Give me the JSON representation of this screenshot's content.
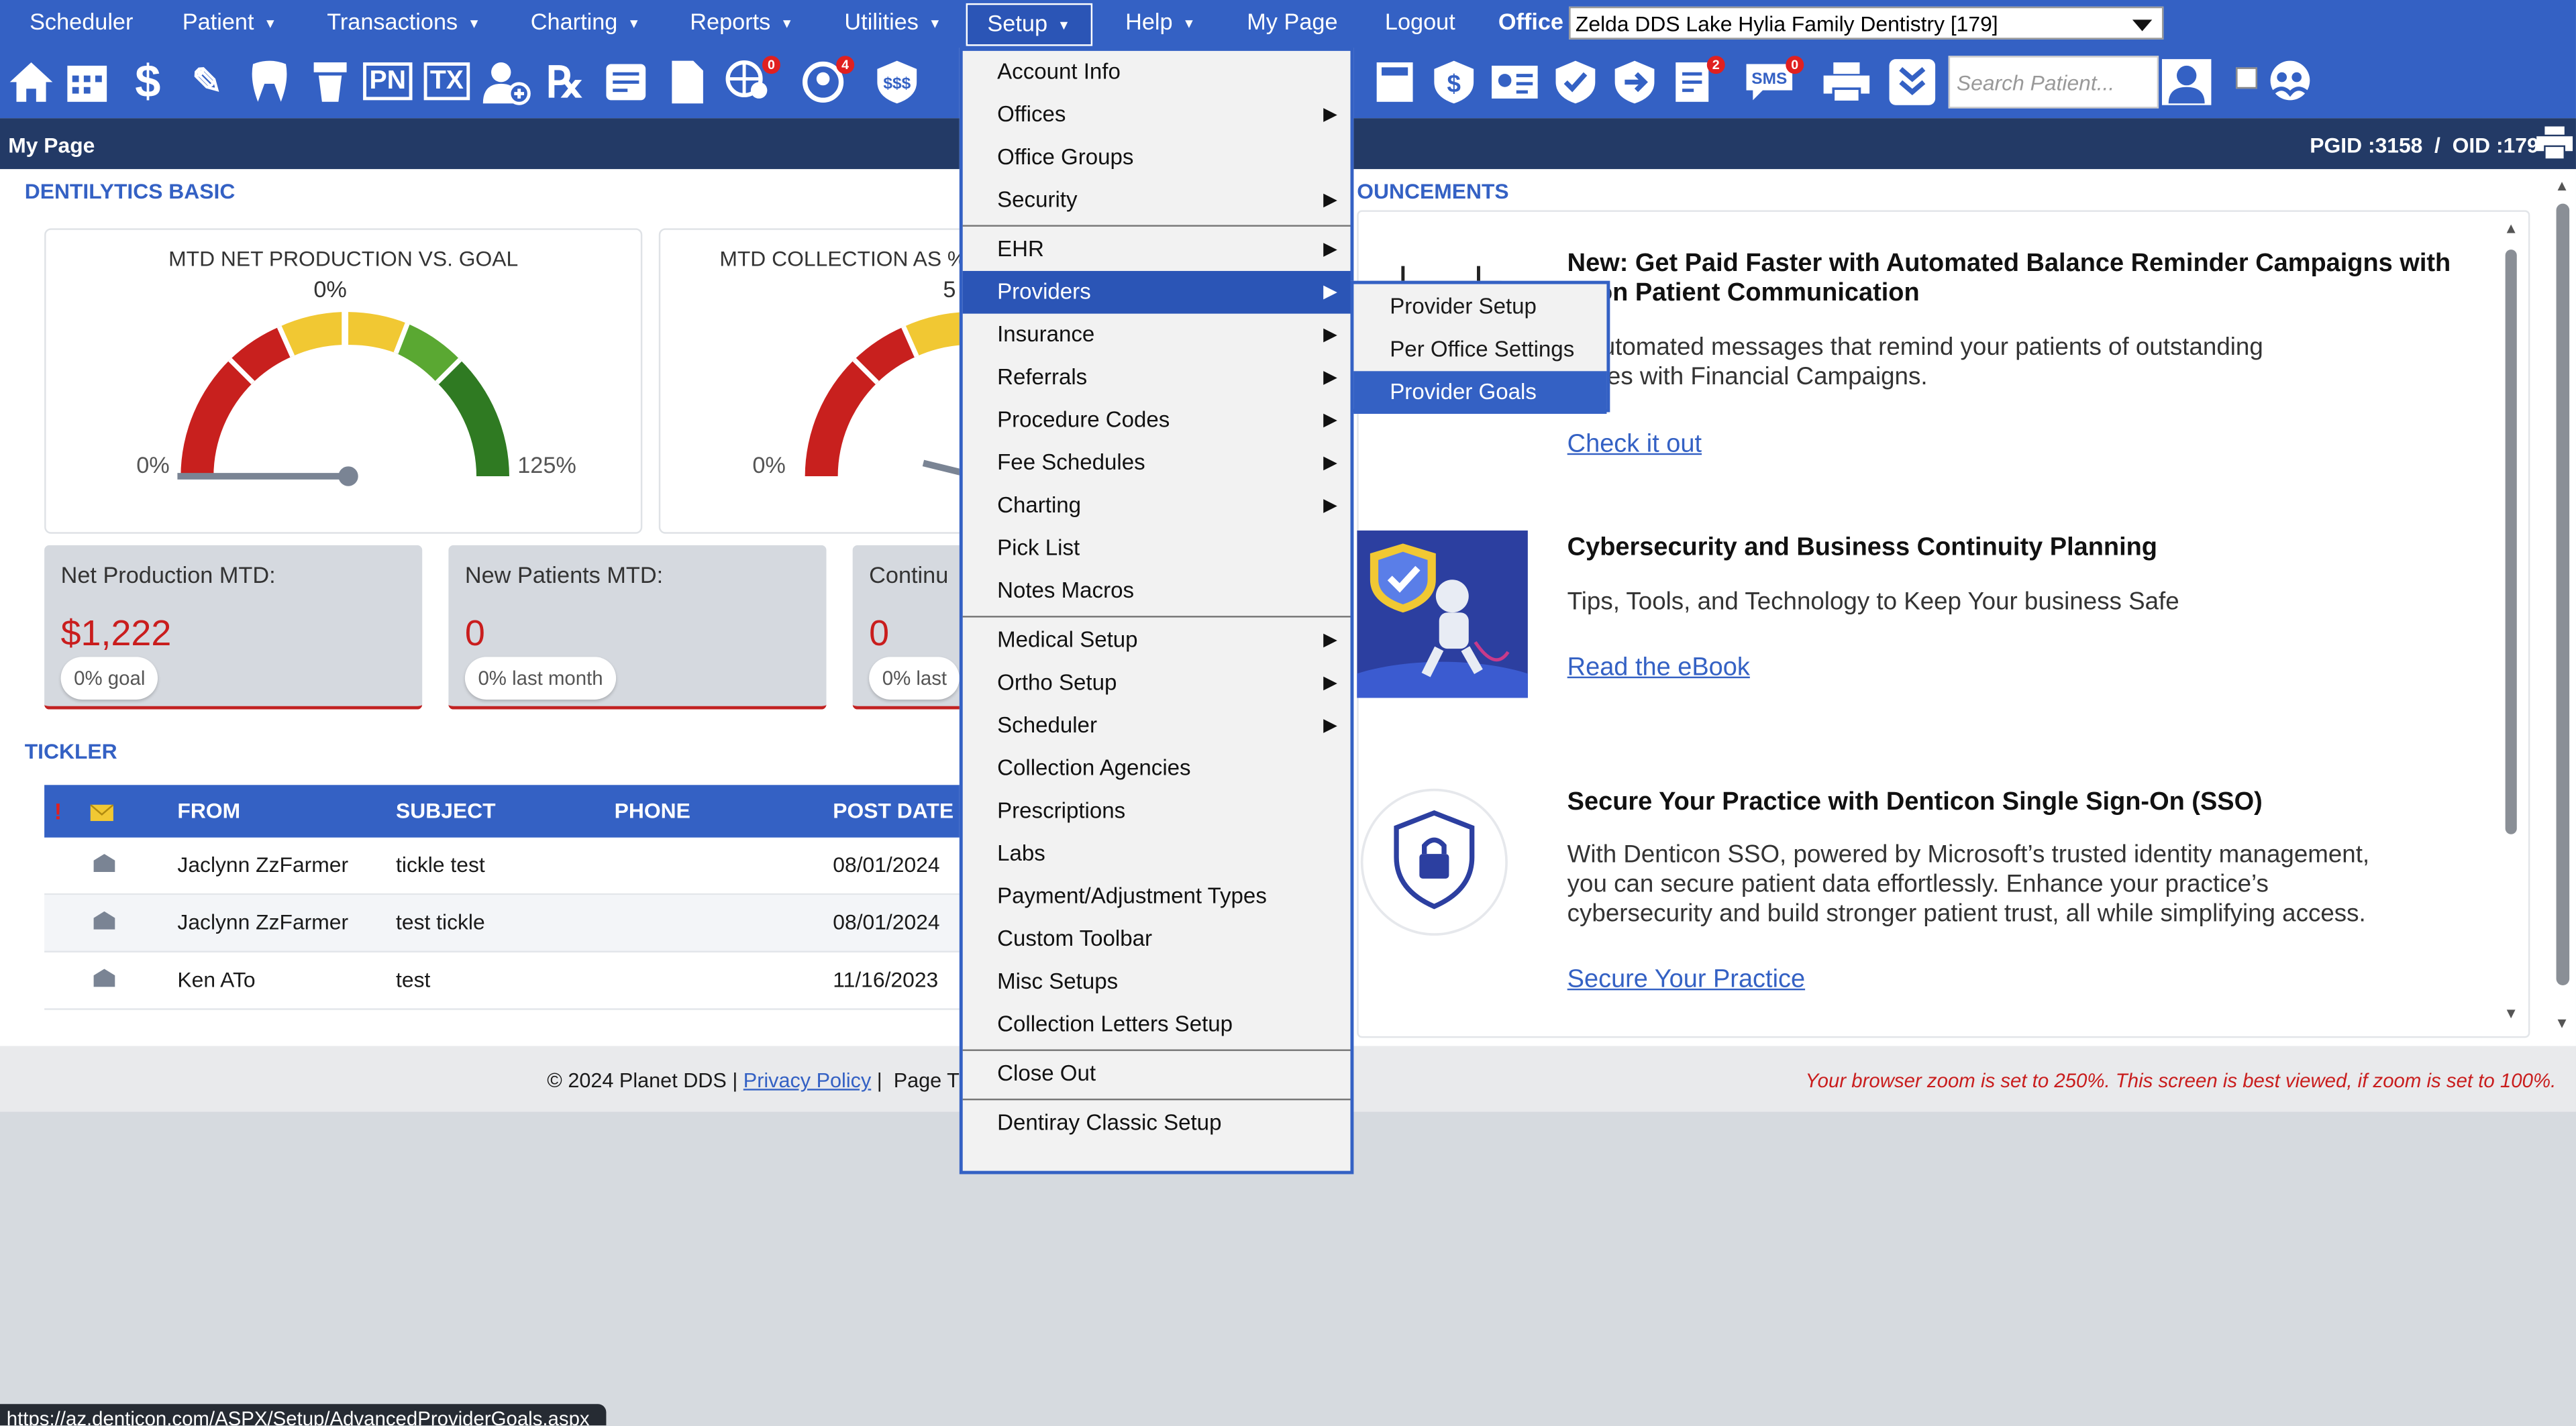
{
  "menu": {
    "items": [
      "Scheduler",
      "Patient",
      "Transactions",
      "Charting",
      "Reports",
      "Utilities",
      "Setup",
      "Help",
      "My Page",
      "Logout"
    ],
    "office_label": "Office",
    "office_value": "Zelda DDS Lake Hylia Family Dentistry [179]"
  },
  "toolbar": {
    "icons": [
      "home-icon",
      "calendar-icon",
      "dollar-icon",
      "edit-icon",
      "tooth-icon",
      "tooth-implant-icon",
      "pn-icon",
      "tx-icon",
      "add-user-icon",
      "rx-icon",
      "notes-icon",
      "document-icon",
      "globe-user-icon",
      "refresh-user-icon",
      "insurance-money-icon",
      "calculator-icon",
      "shield-dollar-icon",
      "id-card-icon",
      "shield-check-icon",
      "shield-forward-icon",
      "checklist-icon",
      "sms-icon",
      "printer-icon",
      "chevron-double-down-icon",
      "user-search-icon"
    ],
    "badges": {
      "globe": "0",
      "refresh": "4",
      "checklist": "2",
      "sms": "0"
    },
    "search_placeholder": "Search Patient..."
  },
  "header": {
    "page_title": "My Page",
    "ids": "PGID :3158  /  OID :179"
  },
  "dentilytics": {
    "section_title": "DENTILYTICS BASIC",
    "gauge1": {
      "title": "MTD NET PRODUCTION VS. GOAL",
      "value": "0%",
      "min": "0%",
      "max": "125%",
      "level": 0
    },
    "gauge2": {
      "title": "MTD COLLECTION AS %",
      "value": "5",
      "min": "0%"
    },
    "kpis": [
      {
        "label": "Net Production MTD:",
        "value": "$1,222",
        "pill": "0% goal"
      },
      {
        "label": "New Patients MTD:",
        "value": "0",
        "pill": "0% last month"
      },
      {
        "label": "Continu",
        "value": "0",
        "pill": "0% last"
      }
    ]
  },
  "tickler": {
    "section_title": "TICKLER",
    "columns": [
      "FROM",
      "SUBJECT",
      "PHONE",
      "POST DATE"
    ],
    "flag_symbol": "!",
    "rows": [
      {
        "from": "Jaclynn ZzFarmer",
        "subject": "tickle test",
        "phone": "",
        "date": "08/01/2024"
      },
      {
        "from": "Jaclynn ZzFarmer",
        "subject": "test tickle",
        "phone": "",
        "date": "08/01/2024"
      },
      {
        "from": "Ken ATo",
        "subject": "test",
        "phone": "",
        "date": "11/16/2023"
      }
    ]
  },
  "announcements": {
    "section_title": "OUNCEMENTS",
    "items": [
      {
        "heading_line1": "New: Get Paid Faster with Automated Balance Reminder Campaigns with",
        "heading_line2": "ticon Patient Communication",
        "body_line1": "d automated messages that remind your patients of outstanding",
        "body_line2": "ances with Financial Campaigns.",
        "body_line3": "",
        "link": "Check it out"
      },
      {
        "heading_line1": "Cybersecurity and Business Continuity Planning",
        "heading_line2": "",
        "body_line1": "Tips, Tools, and Technology to Keep Your business Safe",
        "body_line2": "",
        "body_line3": "",
        "link": "Read the eBook"
      },
      {
        "heading_line1": "Secure Your Practice with Denticon Single Sign-On (SSO)",
        "heading_line2": "",
        "body_line1": "With Denticon SSO, powered by Microsoft’s trusted identity management,",
        "body_line2": "you can secure patient data effortlessly. Enhance your practice’s",
        "body_line3": "cybersecurity and build stronger patient trust, all while simplifying access.",
        "link": "Secure Your Practice"
      }
    ]
  },
  "footer": {
    "copyright": "© 2024 Planet DDS | ",
    "privacy": "Privacy Policy",
    "page_time": " |  Page Ti",
    "zoom_warning": "Your browser zoom is set to 250%. This screen is best viewed, if zoom is set to 100%."
  },
  "status_url": "https://az.denticon.com/ASPX/Setup/AdvancedProviderGoals.aspx",
  "setup_menu": {
    "items": [
      {
        "label": "Account Info",
        "submenu": false
      },
      {
        "label": "Offices",
        "submenu": true
      },
      {
        "label": "Office Groups",
        "submenu": false
      },
      {
        "label": "Security",
        "submenu": true
      },
      {
        "label": "EHR",
        "submenu": true
      },
      {
        "label": "Providers",
        "submenu": true,
        "selected": true
      },
      {
        "label": "Insurance",
        "submenu": true
      },
      {
        "label": "Referrals",
        "submenu": true
      },
      {
        "label": "Procedure Codes",
        "submenu": true
      },
      {
        "label": "Fee Schedules",
        "submenu": true
      },
      {
        "label": "Charting",
        "submenu": true
      },
      {
        "label": "Pick List",
        "submenu": false
      },
      {
        "label": "Notes Macros",
        "submenu": false
      },
      {
        "label": "Medical Setup",
        "submenu": true
      },
      {
        "label": "Ortho Setup",
        "submenu": true
      },
      {
        "label": "Scheduler",
        "submenu": true
      },
      {
        "label": "Collection Agencies",
        "submenu": false
      },
      {
        "label": "Prescriptions",
        "submenu": false
      },
      {
        "label": "Labs",
        "submenu": false
      },
      {
        "label": "Payment/Adjustment Types",
        "submenu": false
      },
      {
        "label": "Custom Toolbar",
        "submenu": false
      },
      {
        "label": "Misc Setups",
        "submenu": false
      },
      {
        "label": "Collection Letters Setup",
        "submenu": false
      },
      {
        "label": "Close Out",
        "submenu": false
      },
      {
        "label": "Dentiray Classic Setup",
        "submenu": false
      }
    ],
    "arrow_symbol": "▶"
  },
  "providers_submenu": {
    "items": [
      {
        "label": "Provider Setup"
      },
      {
        "label": "Per Office Settings"
      },
      {
        "label": "Provider Goals",
        "selected": true
      }
    ]
  },
  "colors": {
    "primary": "#3461c4",
    "header": "#233a66",
    "alert": "#c91d1d"
  }
}
